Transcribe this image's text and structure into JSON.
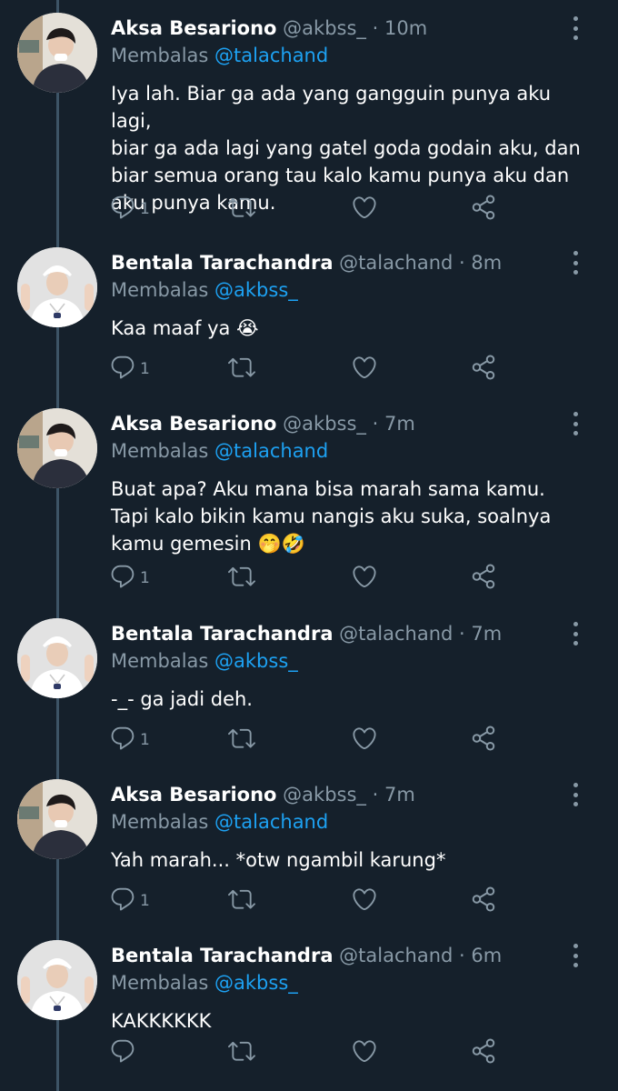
{
  "colors": {
    "background": "#15202b",
    "text": "#ffffff",
    "muted": "#8899a6",
    "link": "#1da1f2",
    "thread_line": "#3d5466"
  },
  "reply_prefix": "Membalas",
  "tweets": [
    {
      "name": "Aksa Besariono",
      "handle": "@akbss_",
      "dot": "·",
      "time": "10m",
      "reply_to": "@talachand",
      "lines": [
        "Iya lah. Biar ga ada yang gangguin punya aku lagi,",
        "biar ga ada lagi yang gatel goda godain aku, dan",
        "biar semua orang tau kalo kamu punya aku dan",
        "aku punya kamu."
      ],
      "reply_count": "1",
      "avatar": "avatar-aksa"
    },
    {
      "name": "Bentala Tarachandra",
      "handle": "@talachand",
      "dot": "·",
      "time": "8m",
      "reply_to": "@akbss_",
      "lines": [
        "Kaa maaf ya 😭"
      ],
      "reply_count": "1",
      "avatar": "avatar-bentala"
    },
    {
      "name": "Aksa Besariono",
      "handle": "@akbss_",
      "dot": "·",
      "time": "7m",
      "reply_to": "@talachand",
      "lines": [
        "Buat apa? Aku mana bisa marah sama kamu.",
        "Tapi kalo bikin kamu nangis aku suka, soalnya",
        "kamu gemesin 🤭🤣"
      ],
      "reply_count": "1",
      "avatar": "avatar-aksa"
    },
    {
      "name": "Bentala Tarachandra",
      "handle": "@talachand",
      "dot": "·",
      "time": "7m",
      "reply_to": "@akbss_",
      "lines": [
        "-_- ga jadi deh."
      ],
      "reply_count": "1",
      "avatar": "avatar-bentala"
    },
    {
      "name": "Aksa Besariono",
      "handle": "@akbss_",
      "dot": "·",
      "time": "7m",
      "reply_to": "@talachand",
      "lines": [
        "Yah marah... *otw ngambil karung*"
      ],
      "reply_count": "1",
      "avatar": "avatar-aksa"
    },
    {
      "name": "Bentala Tarachandra",
      "handle": "@talachand",
      "dot": "·",
      "time": "6m",
      "reply_to": "@akbss_",
      "lines": [
        "KAKKKKKK"
      ],
      "reply_count": "",
      "avatar": "avatar-bentala"
    }
  ]
}
